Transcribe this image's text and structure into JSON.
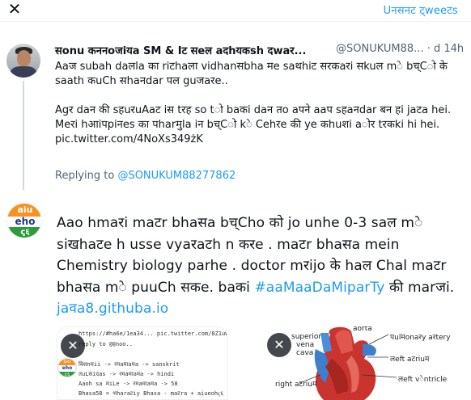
{
  "topbar": {
    "close_glyph": "✕",
    "unsent_label": "Uनसनट ट्weeटs"
  },
  "parent": {
    "name": "सonu कननoजiयa SM & Iट सeल aदhयकsh दwaर...",
    "handle": "@SONUKUM88...",
    "time": "d 14h",
    "paragraph1": "Aaज subah daलla का riटhaला vidhanसbha मe saथhiट सरकaरi सkuल mे bच्Cो के saath कuCh सhaनdar पल guजaरe..",
    "paragraph2": "Agर daन की sहuरuAaट iस tरह so tो baकi daन तo aपने aaप sहaनdar बन हi jaटa hei. Meरi hआiपpiनes का पharमुla iन bच्Cो kे Cehरe की ye कhuशi aोर tरकki hi hei. pic.twitter.com/4NoXs349żK",
    "replying_prefix": "Replying to ",
    "replying_mention": "@SONUKUM88277862"
  },
  "reply_avatar": {
    "top": "aiu",
    "mid": "eho",
    "bot": "ҁ६"
  },
  "compose": {
    "text1": "Aao hmaरi maटr bhaसa bच्Cho को jo unhe 0-3 saल mे siखhaटe h usse vyaरaटh n करe . maटr bhaसa mein Chemistry biology parhe . doctor mरijo के haल Chal maटr bhaसa mे puuCh सकe. baकi ",
    "hashtag": "#aaMaaDaMiparTy",
    "text2": " की marजi. ",
    "url": "jaवa8.githuba.io"
  },
  "media": {
    "left_lines": [
      "https://#ha6e/1ea34...  pic.twitter.com/8Z1uwa9EX",
      "reply to @हnoo..",
      "विशnमii -> रमaमाaमa -> sanskrit",
      "तuLसiदas -> रमaमाaमa -> hindi",
      "Aaoh sa मiLe -> रमaमाaमa -> 58",
      "Bhasa58 = भharaटiy Bhasa - maटra + aiueohҁ६"
    ],
    "logo": {
      "a": "aiu",
      "b": "eho",
      "c": "ҁ६"
    },
    "heart_labels": {
      "aorta": "aorta",
      "pulmonary": "पulमonaरy aरtery",
      "superior": "superior",
      "vena": "vena",
      "cava": "cava",
      "left_atrium": "लeft aटriuम",
      "left_ventricle": "लeft vेntricle",
      "right_atrium": "right aटriuम"
    },
    "remove_glyph": "✕"
  }
}
